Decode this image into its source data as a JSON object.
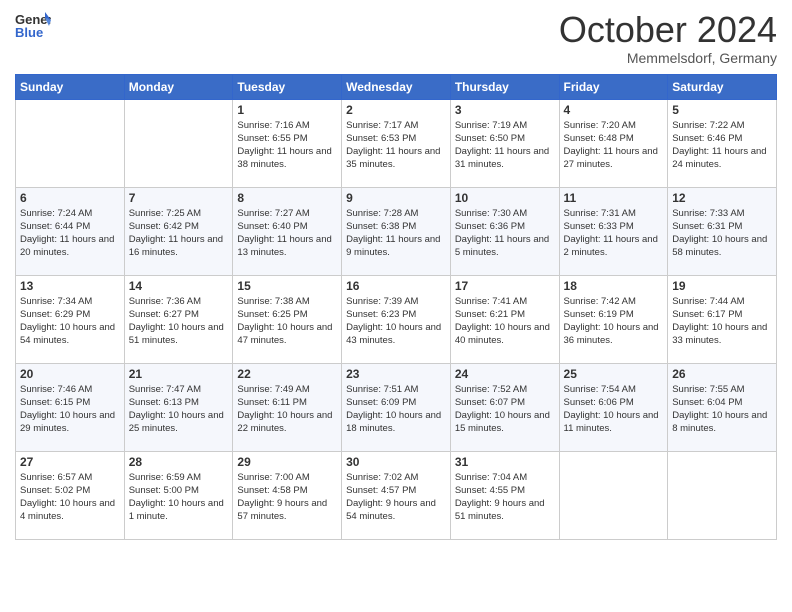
{
  "header": {
    "logo_general": "General",
    "logo_blue": "Blue",
    "month": "October 2024",
    "location": "Memmelsdorf, Germany"
  },
  "weekdays": [
    "Sunday",
    "Monday",
    "Tuesday",
    "Wednesday",
    "Thursday",
    "Friday",
    "Saturday"
  ],
  "weeks": [
    [
      {
        "day": "",
        "sunrise": "",
        "sunset": "",
        "daylight": ""
      },
      {
        "day": "",
        "sunrise": "",
        "sunset": "",
        "daylight": ""
      },
      {
        "day": "1",
        "sunrise": "Sunrise: 7:16 AM",
        "sunset": "Sunset: 6:55 PM",
        "daylight": "Daylight: 11 hours and 38 minutes."
      },
      {
        "day": "2",
        "sunrise": "Sunrise: 7:17 AM",
        "sunset": "Sunset: 6:53 PM",
        "daylight": "Daylight: 11 hours and 35 minutes."
      },
      {
        "day": "3",
        "sunrise": "Sunrise: 7:19 AM",
        "sunset": "Sunset: 6:50 PM",
        "daylight": "Daylight: 11 hours and 31 minutes."
      },
      {
        "day": "4",
        "sunrise": "Sunrise: 7:20 AM",
        "sunset": "Sunset: 6:48 PM",
        "daylight": "Daylight: 11 hours and 27 minutes."
      },
      {
        "day": "5",
        "sunrise": "Sunrise: 7:22 AM",
        "sunset": "Sunset: 6:46 PM",
        "daylight": "Daylight: 11 hours and 24 minutes."
      }
    ],
    [
      {
        "day": "6",
        "sunrise": "Sunrise: 7:24 AM",
        "sunset": "Sunset: 6:44 PM",
        "daylight": "Daylight: 11 hours and 20 minutes."
      },
      {
        "day": "7",
        "sunrise": "Sunrise: 7:25 AM",
        "sunset": "Sunset: 6:42 PM",
        "daylight": "Daylight: 11 hours and 16 minutes."
      },
      {
        "day": "8",
        "sunrise": "Sunrise: 7:27 AM",
        "sunset": "Sunset: 6:40 PM",
        "daylight": "Daylight: 11 hours and 13 minutes."
      },
      {
        "day": "9",
        "sunrise": "Sunrise: 7:28 AM",
        "sunset": "Sunset: 6:38 PM",
        "daylight": "Daylight: 11 hours and 9 minutes."
      },
      {
        "day": "10",
        "sunrise": "Sunrise: 7:30 AM",
        "sunset": "Sunset: 6:36 PM",
        "daylight": "Daylight: 11 hours and 5 minutes."
      },
      {
        "day": "11",
        "sunrise": "Sunrise: 7:31 AM",
        "sunset": "Sunset: 6:33 PM",
        "daylight": "Daylight: 11 hours and 2 minutes."
      },
      {
        "day": "12",
        "sunrise": "Sunrise: 7:33 AM",
        "sunset": "Sunset: 6:31 PM",
        "daylight": "Daylight: 10 hours and 58 minutes."
      }
    ],
    [
      {
        "day": "13",
        "sunrise": "Sunrise: 7:34 AM",
        "sunset": "Sunset: 6:29 PM",
        "daylight": "Daylight: 10 hours and 54 minutes."
      },
      {
        "day": "14",
        "sunrise": "Sunrise: 7:36 AM",
        "sunset": "Sunset: 6:27 PM",
        "daylight": "Daylight: 10 hours and 51 minutes."
      },
      {
        "day": "15",
        "sunrise": "Sunrise: 7:38 AM",
        "sunset": "Sunset: 6:25 PM",
        "daylight": "Daylight: 10 hours and 47 minutes."
      },
      {
        "day": "16",
        "sunrise": "Sunrise: 7:39 AM",
        "sunset": "Sunset: 6:23 PM",
        "daylight": "Daylight: 10 hours and 43 minutes."
      },
      {
        "day": "17",
        "sunrise": "Sunrise: 7:41 AM",
        "sunset": "Sunset: 6:21 PM",
        "daylight": "Daylight: 10 hours and 40 minutes."
      },
      {
        "day": "18",
        "sunrise": "Sunrise: 7:42 AM",
        "sunset": "Sunset: 6:19 PM",
        "daylight": "Daylight: 10 hours and 36 minutes."
      },
      {
        "day": "19",
        "sunrise": "Sunrise: 7:44 AM",
        "sunset": "Sunset: 6:17 PM",
        "daylight": "Daylight: 10 hours and 33 minutes."
      }
    ],
    [
      {
        "day": "20",
        "sunrise": "Sunrise: 7:46 AM",
        "sunset": "Sunset: 6:15 PM",
        "daylight": "Daylight: 10 hours and 29 minutes."
      },
      {
        "day": "21",
        "sunrise": "Sunrise: 7:47 AM",
        "sunset": "Sunset: 6:13 PM",
        "daylight": "Daylight: 10 hours and 25 minutes."
      },
      {
        "day": "22",
        "sunrise": "Sunrise: 7:49 AM",
        "sunset": "Sunset: 6:11 PM",
        "daylight": "Daylight: 10 hours and 22 minutes."
      },
      {
        "day": "23",
        "sunrise": "Sunrise: 7:51 AM",
        "sunset": "Sunset: 6:09 PM",
        "daylight": "Daylight: 10 hours and 18 minutes."
      },
      {
        "day": "24",
        "sunrise": "Sunrise: 7:52 AM",
        "sunset": "Sunset: 6:07 PM",
        "daylight": "Daylight: 10 hours and 15 minutes."
      },
      {
        "day": "25",
        "sunrise": "Sunrise: 7:54 AM",
        "sunset": "Sunset: 6:06 PM",
        "daylight": "Daylight: 10 hours and 11 minutes."
      },
      {
        "day": "26",
        "sunrise": "Sunrise: 7:55 AM",
        "sunset": "Sunset: 6:04 PM",
        "daylight": "Daylight: 10 hours and 8 minutes."
      }
    ],
    [
      {
        "day": "27",
        "sunrise": "Sunrise: 6:57 AM",
        "sunset": "Sunset: 5:02 PM",
        "daylight": "Daylight: 10 hours and 4 minutes."
      },
      {
        "day": "28",
        "sunrise": "Sunrise: 6:59 AM",
        "sunset": "Sunset: 5:00 PM",
        "daylight": "Daylight: 10 hours and 1 minute."
      },
      {
        "day": "29",
        "sunrise": "Sunrise: 7:00 AM",
        "sunset": "Sunset: 4:58 PM",
        "daylight": "Daylight: 9 hours and 57 minutes."
      },
      {
        "day": "30",
        "sunrise": "Sunrise: 7:02 AM",
        "sunset": "Sunset: 4:57 PM",
        "daylight": "Daylight: 9 hours and 54 minutes."
      },
      {
        "day": "31",
        "sunrise": "Sunrise: 7:04 AM",
        "sunset": "Sunset: 4:55 PM",
        "daylight": "Daylight: 9 hours and 51 minutes."
      },
      {
        "day": "",
        "sunrise": "",
        "sunset": "",
        "daylight": ""
      },
      {
        "day": "",
        "sunrise": "",
        "sunset": "",
        "daylight": ""
      }
    ]
  ]
}
